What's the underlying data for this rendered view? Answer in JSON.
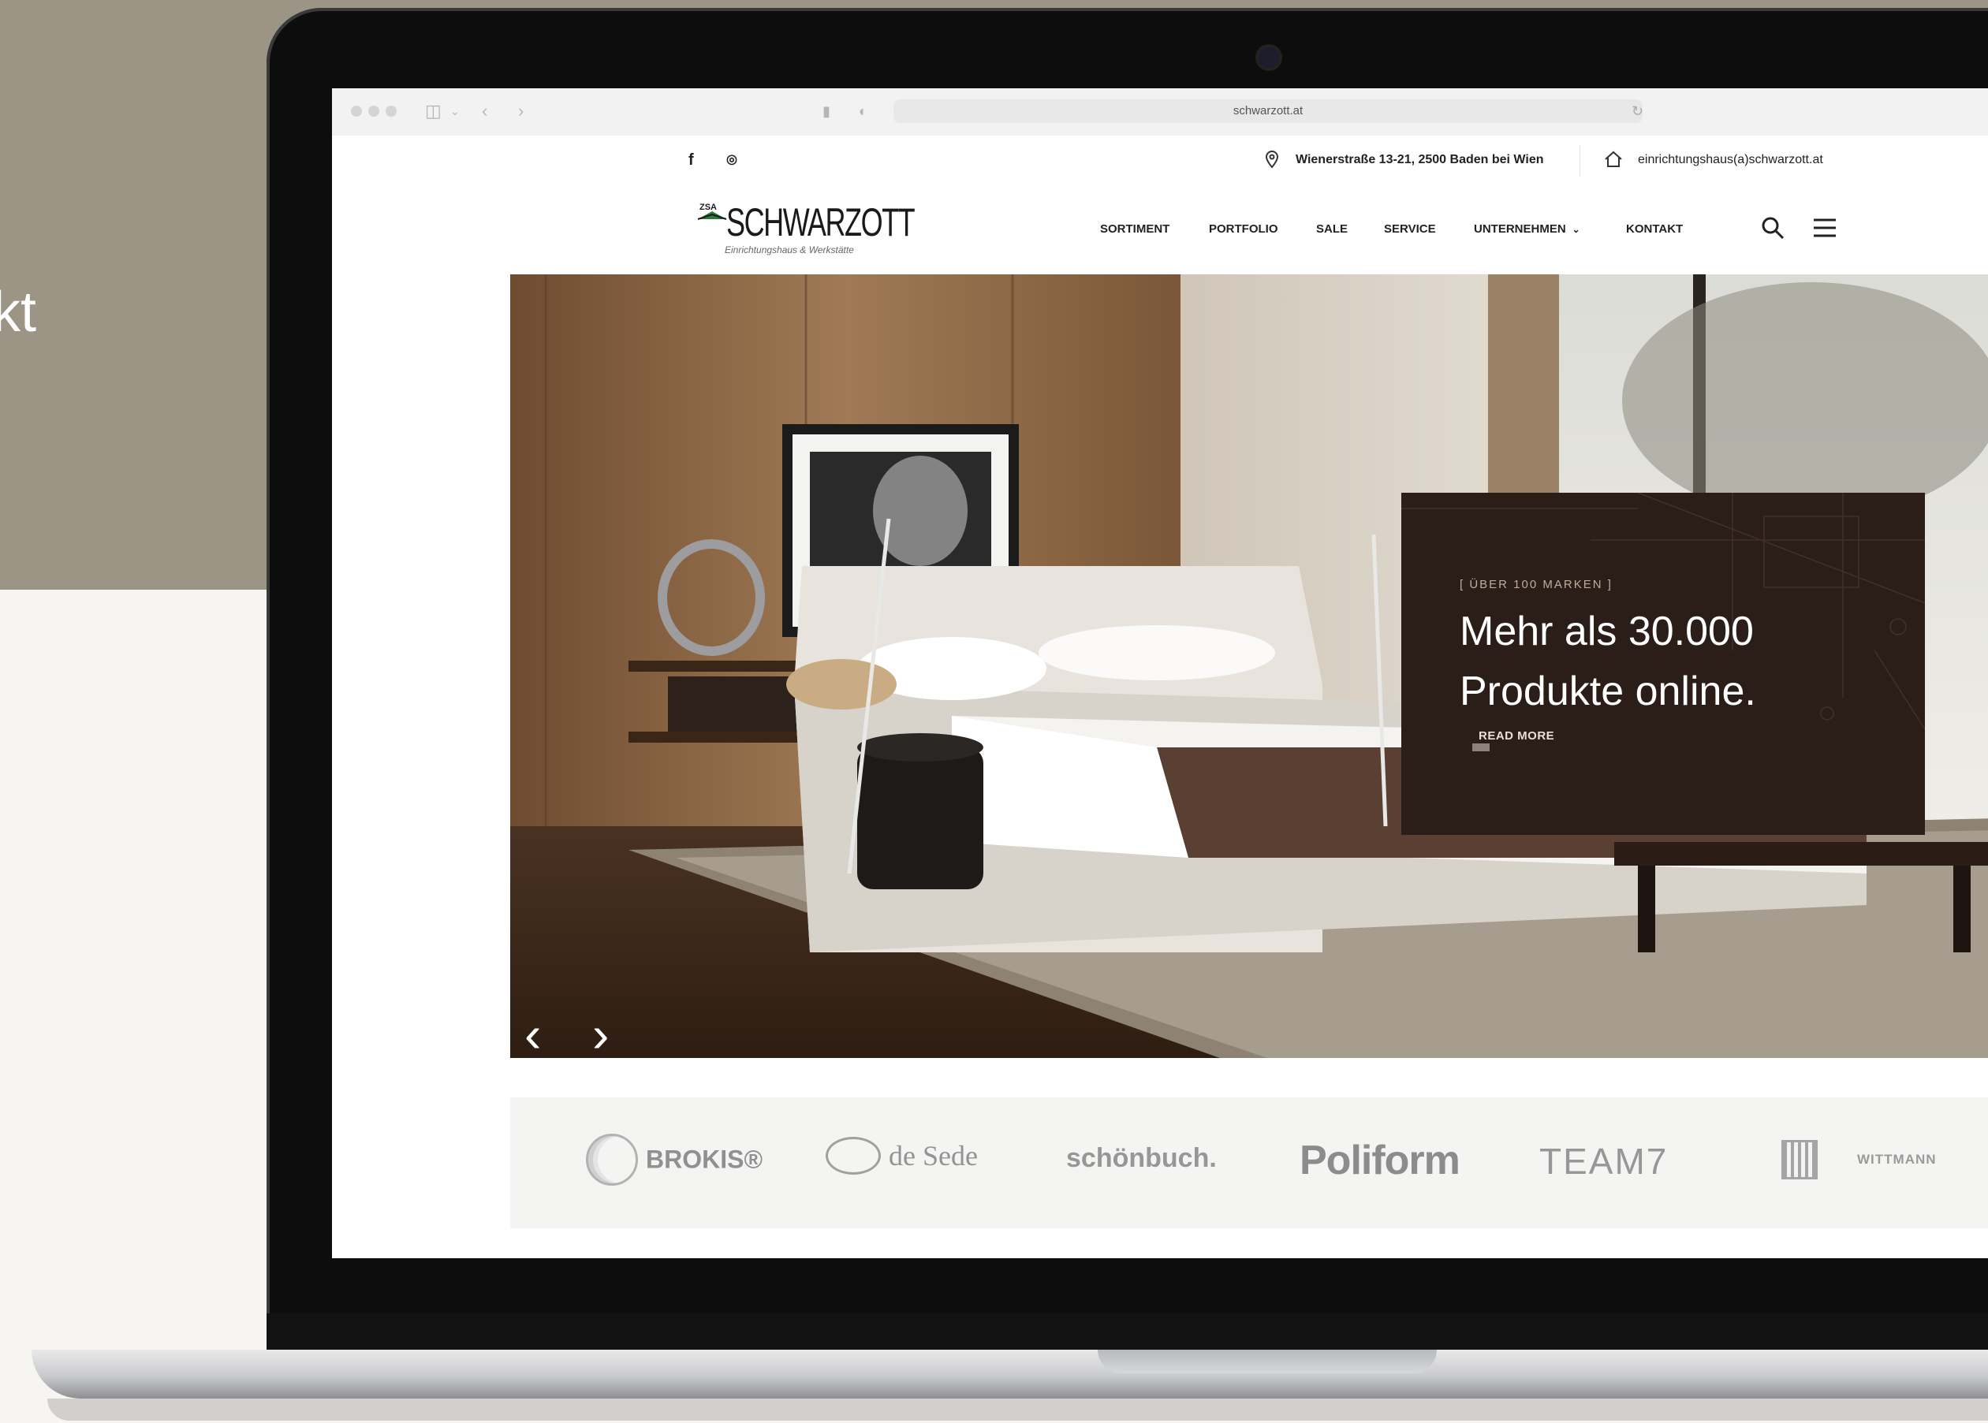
{
  "side_text": "kt",
  "browser": {
    "url": "schwarzott.at"
  },
  "topbar": {
    "social": [
      "f",
      "◎"
    ],
    "address": "Wienerstraße 13-21, 2500 Baden bei Wien",
    "email": "einrichtungshaus(a)schwarzott.at"
  },
  "header": {
    "logo_mark": "ZSA",
    "logo_text": "SCHWARZOTT",
    "logo_sub": "Einrichtungshaus & Werkstätte",
    "nav": [
      "SORTIMENT",
      "PORTFOLIO",
      "SALE",
      "SERVICE",
      "UNTERNEHMEN",
      "KONTAKT"
    ]
  },
  "hero": {
    "kicker": "[ ÜBER 100 MARKEN ]",
    "title": "Mehr als 30.000 Produkte online.",
    "link": "READ MORE",
    "prev": "‹",
    "next": "›"
  },
  "brands": [
    "BROKIS®",
    "de Sede",
    "schönbuch.",
    "Poliform",
    "TEAM7",
    "WITTMANN"
  ],
  "colors": {
    "tan_bg": "#9c9484",
    "card_bg": "#2b1d17",
    "brand_grey": "#8a8a8a"
  }
}
